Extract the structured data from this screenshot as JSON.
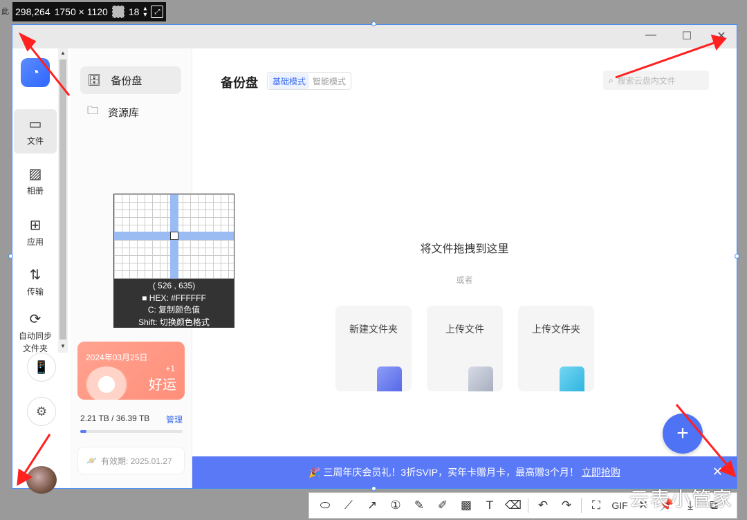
{
  "capture": {
    "position": "298,264",
    "size": "1750 × 1120",
    "border": "18",
    "bg_left": "此"
  },
  "window": {
    "controls": [
      "—",
      "☐",
      "✕"
    ]
  },
  "rail": {
    "items": [
      {
        "label": "文件",
        "icon": "folder-icon",
        "glyph": "▭"
      },
      {
        "label": "相册",
        "icon": "album-icon",
        "glyph": "▨"
      },
      {
        "label": "应用",
        "icon": "apps-icon",
        "glyph": "⊞"
      },
      {
        "label": "传输",
        "icon": "transfer-icon",
        "glyph": "⇅"
      },
      {
        "label": "自动同步\n文件夹",
        "icon": "sync-icon",
        "glyph": "⟳"
      }
    ],
    "phone_icon": "📱",
    "settings_icon": "⚙"
  },
  "sidebar": {
    "items": [
      {
        "label": "备份盘",
        "icon": "backup-disk-icon",
        "glyph": "🗄"
      },
      {
        "label": "资源库",
        "icon": "library-icon",
        "glyph": "🗀"
      }
    ],
    "luck_card": {
      "date": "2024年03月25日",
      "plus": "+1",
      "word": "好运"
    },
    "storage": {
      "text": "2.21 TB / 36.39 TB",
      "manage": "管理",
      "used_fraction": 0.06
    },
    "validity": "有效期: 2025.01.27"
  },
  "main": {
    "title": "备份盘",
    "modes": [
      "基础模式",
      "智能模式"
    ],
    "search_placeholder": "搜索云盘内文件",
    "drop_text": "将文件拖拽到这里",
    "or_text": "或者",
    "actions": [
      "新建文件夹",
      "上传文件",
      "上传文件夹"
    ],
    "fab": "+",
    "promo": {
      "text": "🎉 三周年庆会员礼！3折SVIP，买年卡赠月卡，最高赠3个月！",
      "link": "立即抢购",
      "close": "✕"
    }
  },
  "magnifier": {
    "coords": "( 526 , 635)",
    "hex": "■ HEX:   #FFFFFF",
    "copy_hint": "C: 复制颜色值",
    "shift_hint": "Shift: 切换颜色格式"
  },
  "toolbar": {
    "tools": [
      "⬭",
      "⟋",
      "↗",
      "①",
      "✎",
      "✐",
      "▩",
      "T",
      "⌫",
      "↶",
      "↷",
      "⛶",
      "GIF",
      "✕",
      "📌",
      "⤓",
      "⧉"
    ]
  },
  "watermark": "云表小管家"
}
